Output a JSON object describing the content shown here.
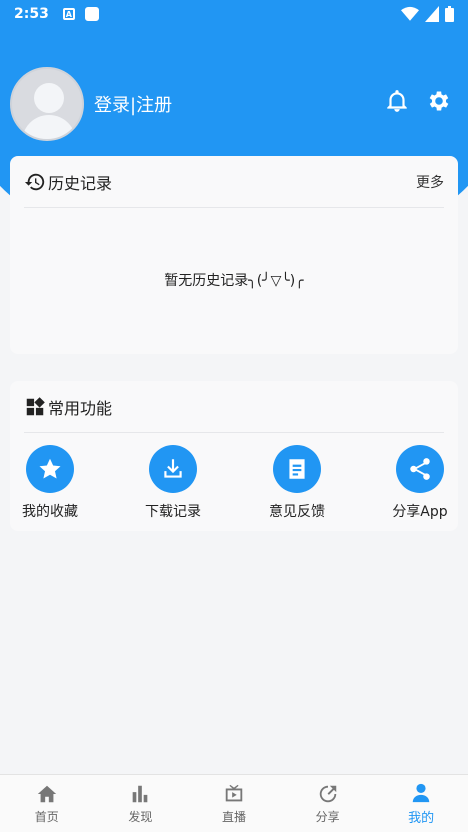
{
  "status_bar": {
    "time": "2:53"
  },
  "profile": {
    "login_label": "登录|注册"
  },
  "history": {
    "title": "历史记录",
    "more": "更多",
    "empty_text": "暂无历史记录╮(╯▽╰)╭"
  },
  "functions": {
    "title": "常用功能",
    "items": [
      {
        "label": "我的收藏",
        "icon": "star-icon"
      },
      {
        "label": "下载记录",
        "icon": "download-icon"
      },
      {
        "label": "意见反馈",
        "icon": "document-icon"
      },
      {
        "label": "分享App",
        "icon": "share-icon"
      }
    ]
  },
  "tabs": [
    {
      "label": "首页",
      "icon": "home-icon"
    },
    {
      "label": "发现",
      "icon": "bar-chart-icon"
    },
    {
      "label": "直播",
      "icon": "tv-icon"
    },
    {
      "label": "分享",
      "icon": "share-arrow-icon"
    },
    {
      "label": "我的",
      "icon": "user-icon",
      "active": true
    }
  ],
  "colors": {
    "primary": "#2196f3",
    "background": "#f4f5f7"
  }
}
